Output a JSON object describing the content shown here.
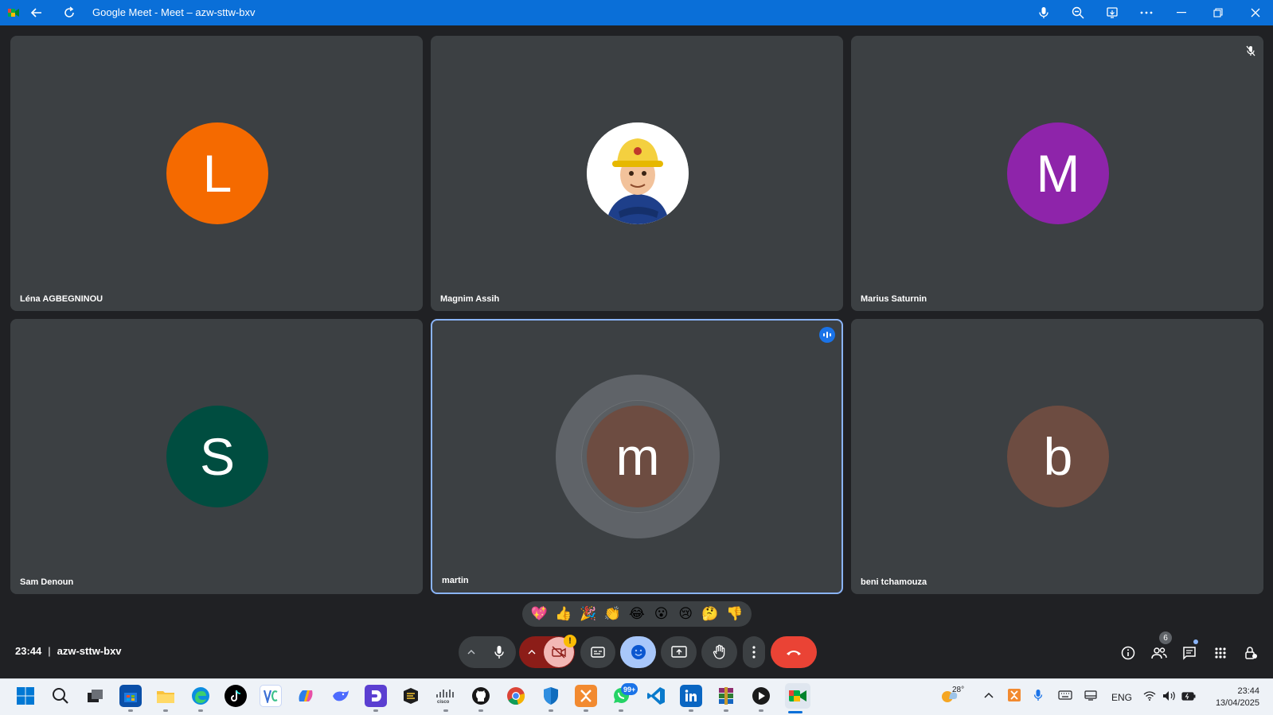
{
  "window": {
    "title": "Google Meet - Meet – azw-sttw-bxv"
  },
  "participants": [
    {
      "name": "Léna AGBEGNINOU",
      "initial": "L",
      "color": "#f56a00"
    },
    {
      "name": "Magnim Assih",
      "initial": "",
      "color": "#ffffff",
      "avatar": "firefighter-cartoon"
    },
    {
      "name": "Marius Saturnin",
      "initial": "M",
      "color": "#8e24aa"
    },
    {
      "name": "Sam Denoun",
      "initial": "S",
      "color": "#004d40"
    },
    {
      "name": "martin",
      "initial": "m",
      "color": "#6d4c41"
    },
    {
      "name": "beni tchamouza",
      "initial": "b",
      "color": "#6d4c41"
    }
  ],
  "reactions": [
    "💖",
    "👍",
    "🎉",
    "👏",
    "😂",
    "😮",
    "😢",
    "🤔",
    "👎"
  ],
  "meeting": {
    "time": "23:44",
    "separator": "|",
    "code": "azw-sttw-bxv"
  },
  "controls": {
    "alert_badge": "!",
    "people_count": "6"
  },
  "taskbar": {
    "whatsapp_badge": "99+",
    "weather_temp": "28°",
    "language": "ENG",
    "clock_time": "23:44",
    "clock_date": "13/04/2025"
  },
  "colors": {
    "titlebar": "#0a6fd8",
    "tile": "#3c4043",
    "background": "#202124",
    "end_call": "#ea4335",
    "active_tile_border": "#8ab4f8"
  }
}
